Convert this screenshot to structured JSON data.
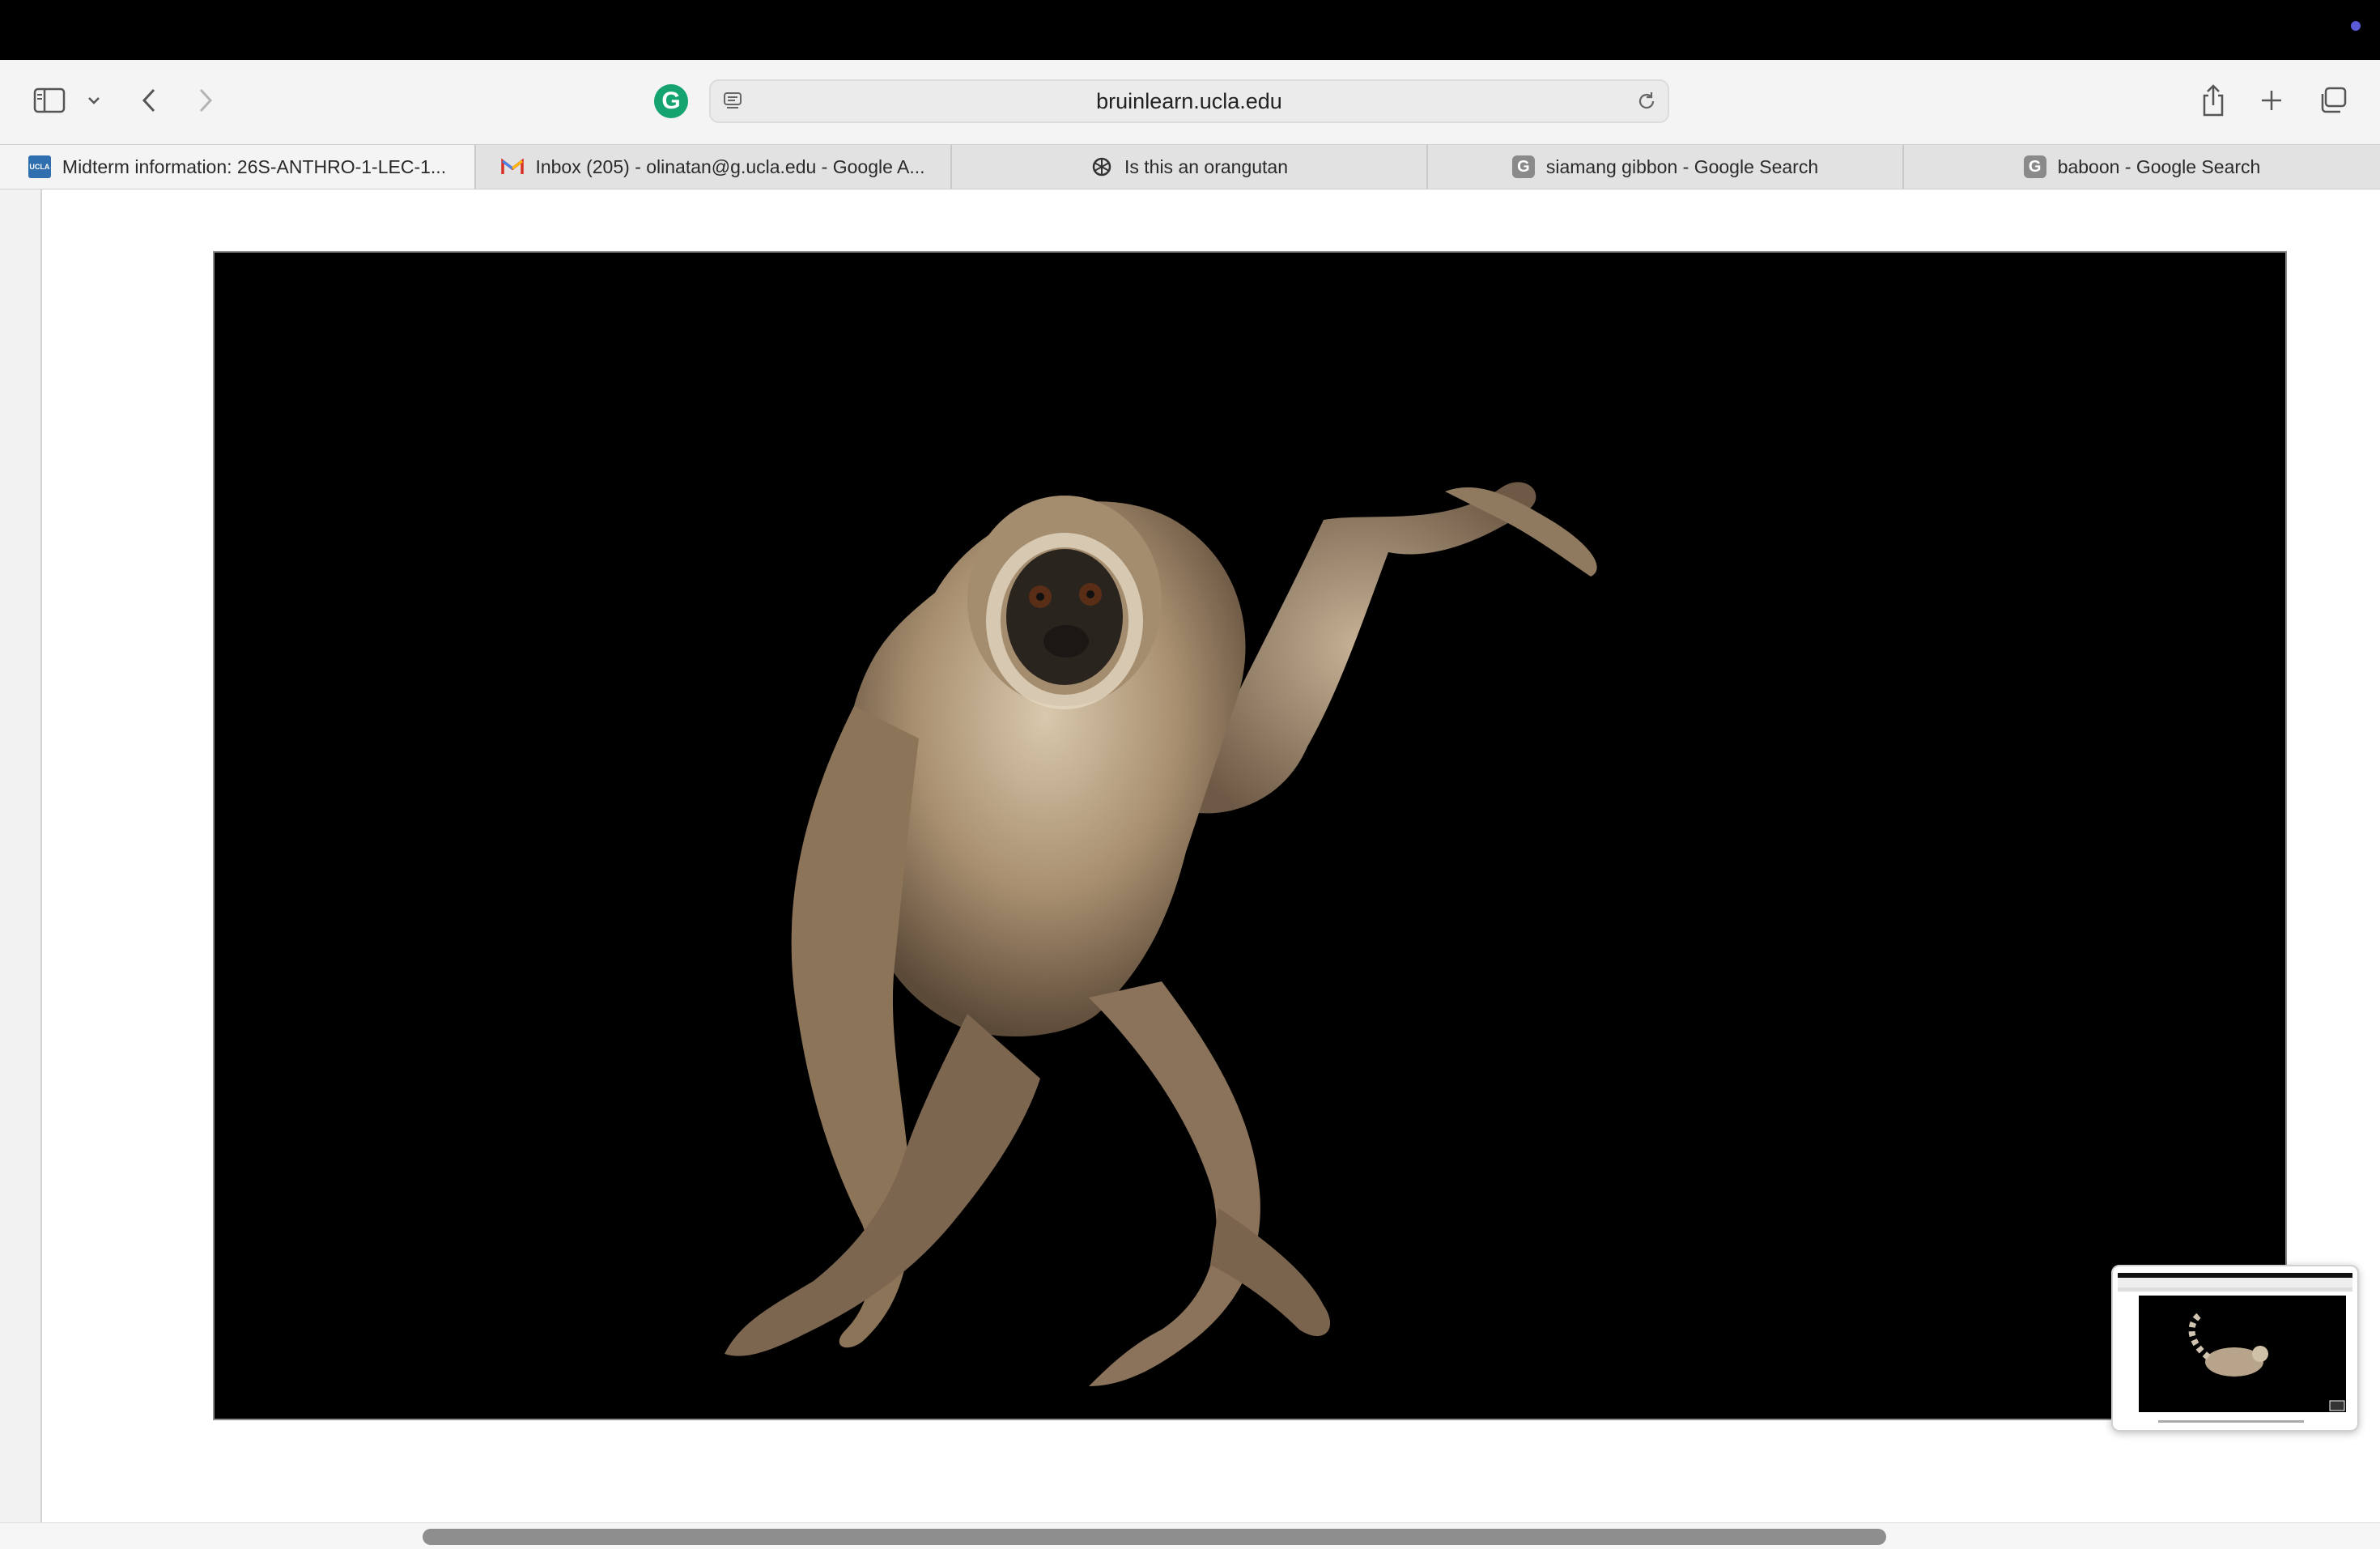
{
  "browser": {
    "url": "bruinlearn.ucla.edu",
    "extension_badge": "G",
    "icons": [
      "sidebar-icon",
      "chevron-down-icon",
      "back-icon",
      "forward-icon",
      "reader-icon",
      "reload-icon",
      "share-icon",
      "new-tab-icon",
      "tab-overview-icon"
    ]
  },
  "tabs": [
    {
      "label": "Midterm information: 26S-ANTHRO-1-LEC-1...",
      "favicon": "UCLA",
      "active": true
    },
    {
      "label": "Inbox (205) - olinatan@g.ucla.edu - Google A...",
      "favicon": "gmail-icon",
      "active": false
    },
    {
      "label": "Is this an orangutan",
      "favicon": "chatgpt-icon",
      "active": false
    },
    {
      "label": "siamang gibbon - Google Search",
      "favicon": "G",
      "active": false
    },
    {
      "label": "baboon - Google Search",
      "favicon": "G",
      "active": false
    }
  ],
  "colors": {
    "menubar": "#000000",
    "toolbar": "#f4f4f4",
    "tabbar": "#e2e2e2",
    "grammarly": "#15a36f",
    "scroll_knob": "#8e8e8e"
  }
}
